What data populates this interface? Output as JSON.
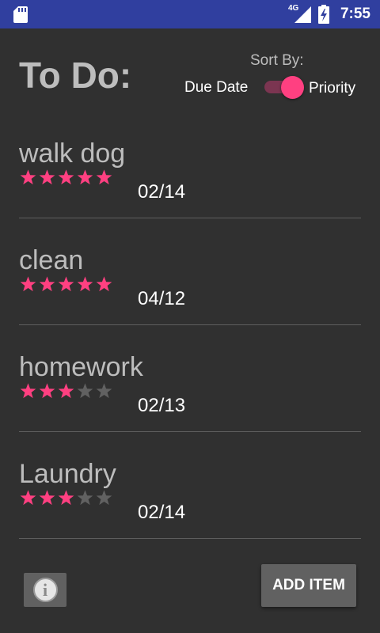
{
  "status_bar": {
    "network_label": "4G",
    "time": "7:55",
    "icons": [
      "sd-card-icon",
      "signal-icon",
      "battery-charging-icon"
    ]
  },
  "header": {
    "title": "To Do:",
    "sort_label": "Sort By:",
    "due_date_label": "Due Date",
    "priority_label": "Priority",
    "sort_by_priority": true
  },
  "colors": {
    "status_bar": "#303f9f",
    "background": "#303030",
    "accent": "#ff4081",
    "star_empty": "#616161"
  },
  "items": [
    {
      "name": "walk dog",
      "rating": 5,
      "max_rating": 5,
      "date": "02/14"
    },
    {
      "name": "clean",
      "rating": 5,
      "max_rating": 5,
      "date": "04/12"
    },
    {
      "name": "homework",
      "rating": 3,
      "max_rating": 5,
      "date": "02/13"
    },
    {
      "name": "Laundry",
      "rating": 3,
      "max_rating": 5,
      "date": "02/14"
    }
  ],
  "footer": {
    "info_icon": "info-icon",
    "add_item_label": "ADD ITEM"
  }
}
